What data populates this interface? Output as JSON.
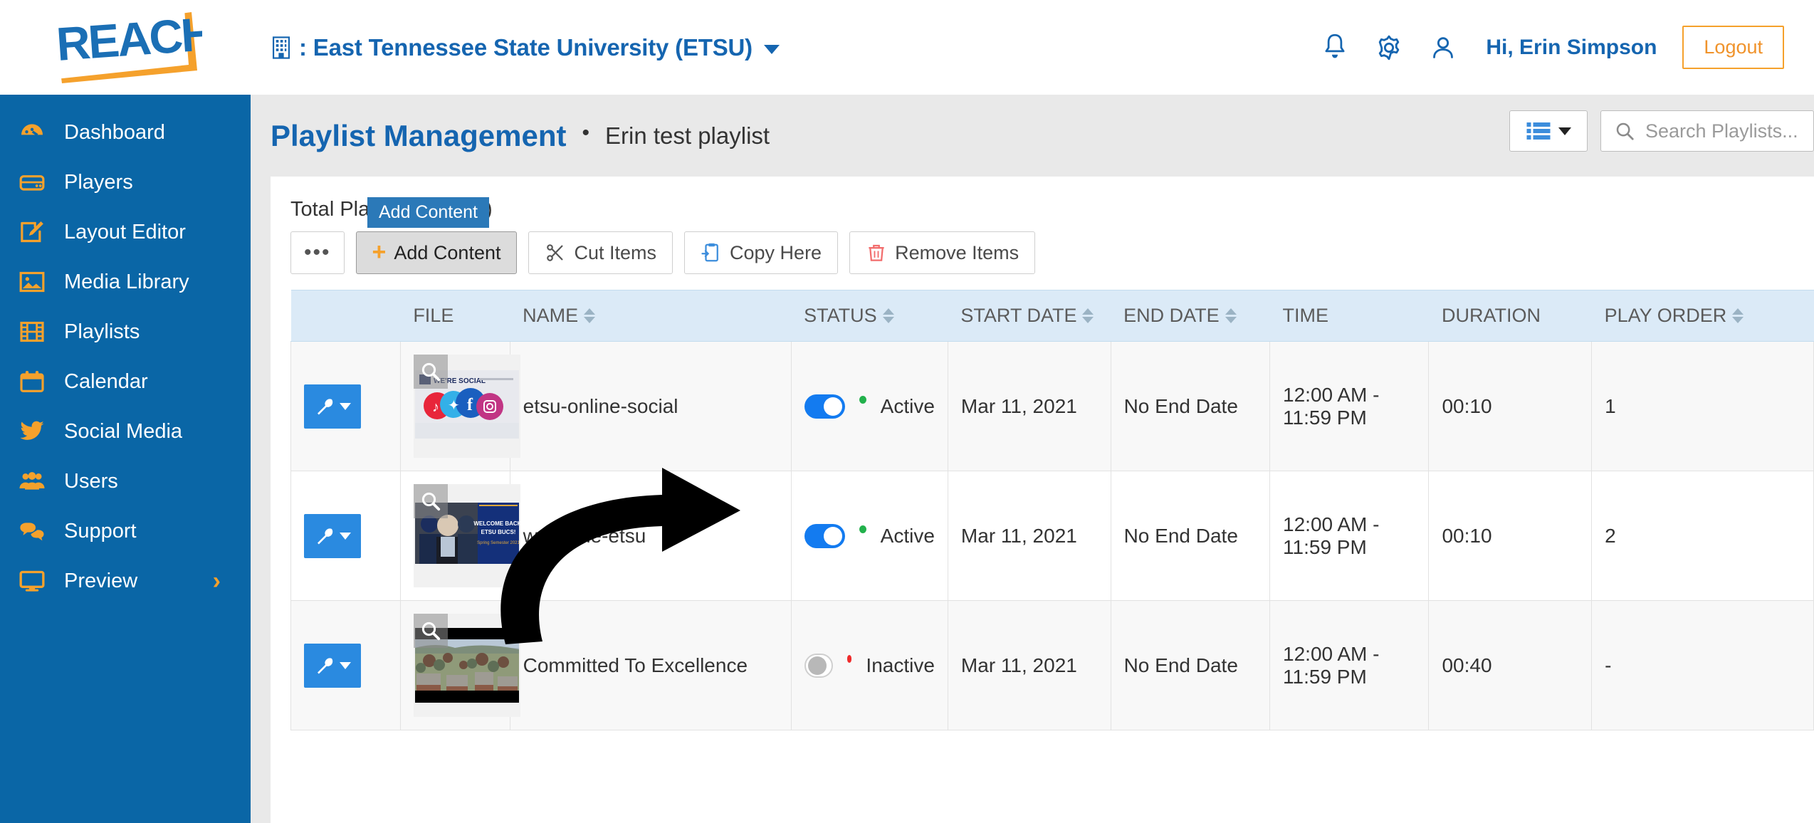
{
  "brand": {
    "logo_text": "REACH"
  },
  "header": {
    "building_icon": "building-icon",
    "org_prefix": ":",
    "org_name": "East Tennessee State University (ETSU)",
    "notifications_icon": "bell-icon",
    "settings_icon": "gear-icon",
    "account_icon": "person-icon",
    "greeting": "Hi, Erin Simpson",
    "logout_label": "Logout"
  },
  "sidebar": {
    "items": [
      {
        "label": "Dashboard",
        "icon": "dashboard-icon"
      },
      {
        "label": "Players",
        "icon": "player-box-icon"
      },
      {
        "label": "Layout Editor",
        "icon": "edit-layout-icon"
      },
      {
        "label": "Media Library",
        "icon": "image-icon"
      },
      {
        "label": "Playlists",
        "icon": "film-icon"
      },
      {
        "label": "Calendar",
        "icon": "calendar-icon"
      },
      {
        "label": "Social Media",
        "icon": "twitter-bird-icon"
      },
      {
        "label": "Users",
        "icon": "users-icon"
      },
      {
        "label": "Support",
        "icon": "chat-bubble-icon"
      },
      {
        "label": "Preview",
        "icon": "monitor-icon",
        "chevron": "›"
      }
    ]
  },
  "page": {
    "title": "Playlist Management",
    "separator": "•",
    "subtitle": "Erin test playlist",
    "view_toggle_icon": "list-view-icon",
    "search": {
      "icon": "search-icon",
      "placeholder": "Search Playlists...",
      "value": ""
    }
  },
  "panel": {
    "total_label": "Total Playlist Items (3)",
    "tooltip": "Add Content",
    "toolbar": [
      {
        "label": "•••",
        "name": "more-options-button",
        "icon": null
      },
      {
        "label": "Add Content",
        "name": "add-content-button",
        "icon": "plus-icon"
      },
      {
        "label": "Cut Items",
        "name": "cut-items-button",
        "icon": "scissors-icon"
      },
      {
        "label": "Copy Here",
        "name": "copy-here-button",
        "icon": "paste-icon"
      },
      {
        "label": "Remove Items",
        "name": "remove-items-button",
        "icon": "trash-icon"
      }
    ],
    "columns": [
      {
        "label": "",
        "sortable": false
      },
      {
        "label": "FILE",
        "sortable": false
      },
      {
        "label": "NAME",
        "sortable": true
      },
      {
        "label": "STATUS",
        "sortable": true
      },
      {
        "label": "START DATE",
        "sortable": true
      },
      {
        "label": "END DATE",
        "sortable": true
      },
      {
        "label": "TIME",
        "sortable": false
      },
      {
        "label": "DURATION",
        "sortable": false
      },
      {
        "label": "PLAY ORDER",
        "sortable": true
      }
    ],
    "rows": [
      {
        "name": "etsu-online-social",
        "status": "Active",
        "status_on": true,
        "start_date": "Mar 11, 2021",
        "end_date": "No End Date",
        "time": "12:00 AM - 11:59 PM",
        "duration": "00:10",
        "play_order": "1",
        "thumb": "social-media-thumbnail"
      },
      {
        "name": "welcome-etsu",
        "status": "Active",
        "status_on": true,
        "start_date": "Mar 11, 2021",
        "end_date": "No End Date",
        "time": "12:00 AM - 11:59 PM",
        "duration": "00:10",
        "play_order": "2",
        "thumb": "graduation-thumbnail"
      },
      {
        "name": "Committed To Excellence",
        "status": "Inactive",
        "status_on": false,
        "start_date": "Mar 11, 2021",
        "end_date": "No End Date",
        "time": "12:00 AM - 11:59 PM",
        "duration": "00:40",
        "play_order": "-",
        "thumb": "campus-aerial-thumbnail"
      }
    ]
  },
  "colors": {
    "sidebar_blue": "#0a66a6",
    "accent_orange": "#f5a12c",
    "link_blue": "#1565b0",
    "toggle_on": "#137bf0",
    "status_active": "#22b14c",
    "status_inactive": "#ef2b2b",
    "table_header": "#dbeaf7"
  }
}
